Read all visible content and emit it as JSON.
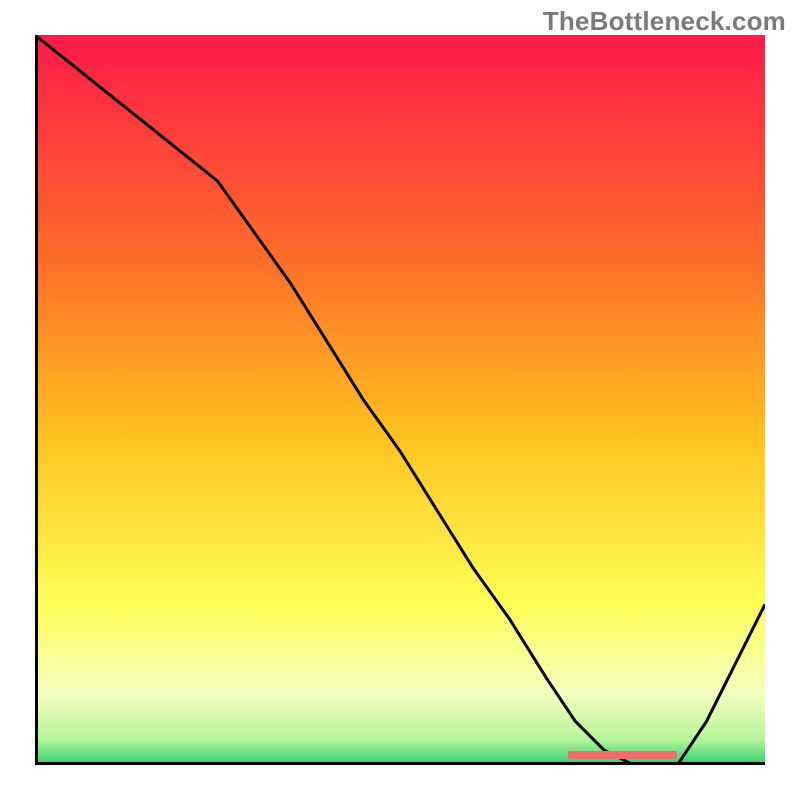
{
  "watermark": "TheBottleneck.com",
  "colors": {
    "axis": "#000000",
    "curve": "#000000",
    "marker": "#ef6f6c",
    "gradient_top": "#ff1a4a",
    "gradient_mid1": "#ff7a1f",
    "gradient_mid2": "#ffd21f",
    "gradient_mid3": "#ffff66",
    "gradient_mid4": "#f7ffb0",
    "gradient_bottom": "#2ecc71"
  },
  "chart_data": {
    "type": "line",
    "title": "",
    "xlabel": "",
    "ylabel": "",
    "xlim": [
      0,
      100
    ],
    "ylim": [
      0,
      100
    ],
    "series": [
      {
        "name": "bottleneck-curve",
        "x": [
          0,
          5,
          10,
          15,
          20,
          25,
          30,
          35,
          40,
          45,
          50,
          55,
          60,
          65,
          70,
          74,
          78,
          82,
          85,
          88,
          92,
          96,
          100
        ],
        "values": [
          100,
          96,
          92,
          88,
          84,
          80,
          73,
          66,
          58,
          50,
          43,
          35,
          27,
          20,
          12,
          6,
          2,
          0,
          0,
          0,
          6,
          14,
          22
        ]
      }
    ],
    "optimal_range_x": [
      73,
      88
    ],
    "gradient_stops": [
      {
        "offset": 0.0,
        "color": "#ff1a4a"
      },
      {
        "offset": 0.3,
        "color": "#ff6a2a"
      },
      {
        "offset": 0.55,
        "color": "#ffc21f"
      },
      {
        "offset": 0.78,
        "color": "#ffff55"
      },
      {
        "offset": 0.9,
        "color": "#f6ffc0"
      },
      {
        "offset": 0.965,
        "color": "#b7f59a"
      },
      {
        "offset": 1.0,
        "color": "#2ecc71"
      }
    ]
  }
}
